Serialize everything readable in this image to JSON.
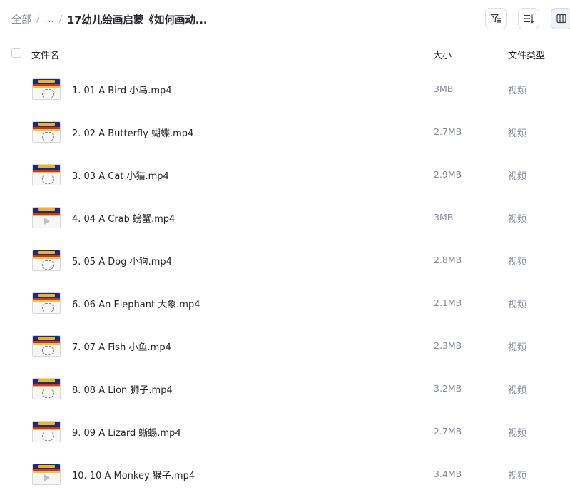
{
  "breadcrumb": {
    "root": "全部",
    "separator": "/",
    "ellipsis": "...",
    "current": "17幼儿绘画启蒙《如何画动..."
  },
  "toolbar": {
    "filter_icon": "filter-icon",
    "sort_icon": "sort-icon",
    "view_icon": "column-view-icon"
  },
  "columns": {
    "name": "文件名",
    "size": "大小",
    "type": "文件类型"
  },
  "files": [
    {
      "name": "1. 01 A Bird 小鸟.mp4",
      "size": "3MB",
      "type": "视频",
      "thumb": "sketch"
    },
    {
      "name": "2. 02 A Butterfly 蝴蝶.mp4",
      "size": "2.7MB",
      "type": "视频",
      "thumb": "sketch"
    },
    {
      "name": "3. 03 A Cat 小猫.mp4",
      "size": "2.9MB",
      "type": "视频",
      "thumb": "sketch"
    },
    {
      "name": "4. 04 A Crab 螃蟹.mp4",
      "size": "3MB",
      "type": "视频",
      "thumb": "play"
    },
    {
      "name": "5. 05 A Dog 小狗.mp4",
      "size": "2.8MB",
      "type": "视频",
      "thumb": "sketch"
    },
    {
      "name": "6. 06 An Elephant 大象.mp4",
      "size": "2.1MB",
      "type": "视频",
      "thumb": "sketch"
    },
    {
      "name": "7. 07 A Fish 小鱼.mp4",
      "size": "2.3MB",
      "type": "视频",
      "thumb": "sketch"
    },
    {
      "name": "8. 08 A Lion 狮子.mp4",
      "size": "3.2MB",
      "type": "视频",
      "thumb": "sketch"
    },
    {
      "name": "9. 09 A Lizard 蜥蜴.mp4",
      "size": "2.7MB",
      "type": "视频",
      "thumb": "sketch"
    },
    {
      "name": "10. 10 A Monkey 猴子.mp4",
      "size": "3.4MB",
      "type": "视频",
      "thumb": "play"
    }
  ]
}
